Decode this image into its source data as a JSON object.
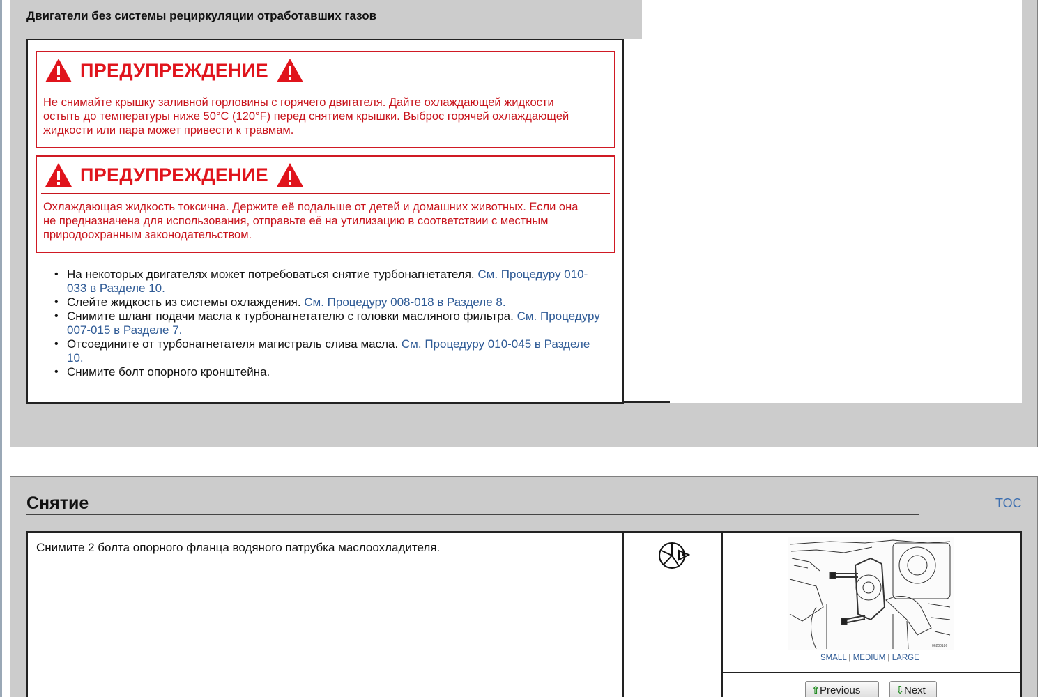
{
  "section1": {
    "heading": "Двигатели без системы рециркуляции отработавших газов",
    "warnings": [
      {
        "title": "ПРЕДУПРЕЖДЕНИЕ",
        "lines": [
          "Не снимайте крышку заливной горловины с горячего двигателя. Дайте охлаждающей жидкости",
          "остыть до температуры ниже 50°C (120°F) перед снятием крышки. Выброс горячей охлаждающей",
          "жидкости или пара может привести к травмам."
        ]
      },
      {
        "title": "ПРЕДУПРЕЖДЕНИЕ",
        "lines": [
          "Охлаждающая жидкость токсична. Держите её подальше от детей и домашних животных. Если она",
          "не предназначена для использования, отправьте её на утилизацию в соответствии с местным",
          "природоохранным законодательством."
        ]
      }
    ],
    "steps": [
      {
        "text": "На некоторых двигателях может потребоваться снятие турбонагнетателя. ",
        "link_1": "См. Процедуру 010-",
        "link_2": "033 в Разделе 10."
      },
      {
        "text": "Слейте жидкость из системы охлаждения. ",
        "link_1": "См. Процедуру 008-018 в Разделе 8."
      },
      {
        "text": "Снимите шланг подачи масла к турбонагнетателю с головки масляного фильтра. ",
        "link_1": "См. Процедуру",
        "link_2": "007-015 в Разделе 7."
      },
      {
        "text": "Отсоедините от турбонагнетателя магистраль слива масла. ",
        "link_1": "См. Процедуру 010-045 в Разделе",
        "link_2": "10."
      },
      {
        "text": "Снимите болт опорного кронштейна."
      }
    ]
  },
  "section2": {
    "title": "Снятие",
    "toc": "TOC",
    "step_text": "Снимите 2 болта опорного фланца водяного патрубка маслоохладителя.",
    "tool_icon": "wrench-socket-icon",
    "figure_id": "06200186",
    "image_sizes": {
      "small": "SMALL",
      "sep": "|",
      "medium": "MEDIUM",
      "large": "LARGE"
    },
    "nav": {
      "previous": "Previous",
      "next": "Next"
    }
  },
  "colors": {
    "warning_red": "#e0141c",
    "link_blue": "#2f5b96",
    "panel_gray": "#cccccc"
  }
}
